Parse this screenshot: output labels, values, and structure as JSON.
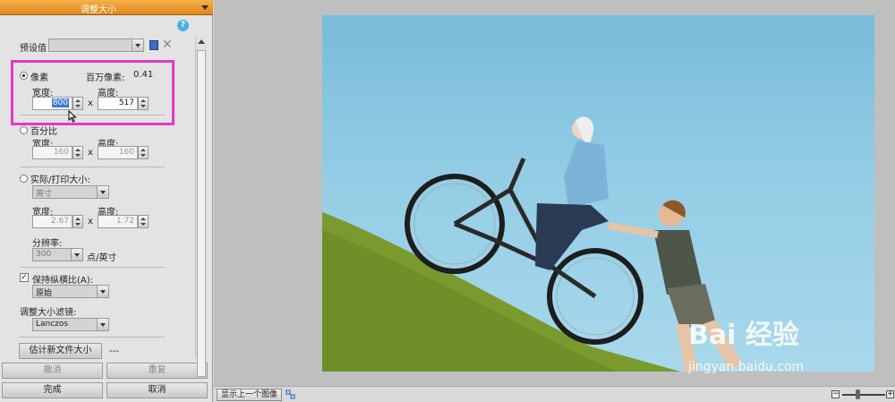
{
  "panel": {
    "title": "调整大小",
    "help_icon": "?",
    "preset_label": "预设值",
    "pixels_label": "像素",
    "megapixels_label": "百万像素:",
    "megapixels_value": "0.41",
    "width_label": "宽度:",
    "height_label": "高度:",
    "times": "x",
    "px_width": "800",
    "px_height": "517",
    "percent_label": "百分比",
    "pct_width": "160",
    "pct_height": "160",
    "print_label": "实际/打印大小:",
    "print_unit": "英寸",
    "print_width": "2.67",
    "print_height": "1.72",
    "resolution_label": "分辨率:",
    "resolution_value": "300",
    "resolution_unit": "点/英寸",
    "keep_ratio_label": "保持纵横比(A):",
    "keep_ratio_mode": "原始",
    "filter_label": "调整大小滤镜:",
    "filter_value": "Lanczos",
    "estimate_button": "估计新文件大小",
    "estimate_result": "---",
    "undo_button": "撤消",
    "redo_button": "重复",
    "done_button": "完成",
    "cancel_button": "取消"
  },
  "viewer": {
    "prev_image_button": "显示上一个图像"
  },
  "watermark": {
    "brand": "Bai 经验",
    "url": "jingyan.baidu.com"
  },
  "colors": {
    "header_orange": "#f5b04a",
    "highlight_magenta": "#e338c8"
  }
}
